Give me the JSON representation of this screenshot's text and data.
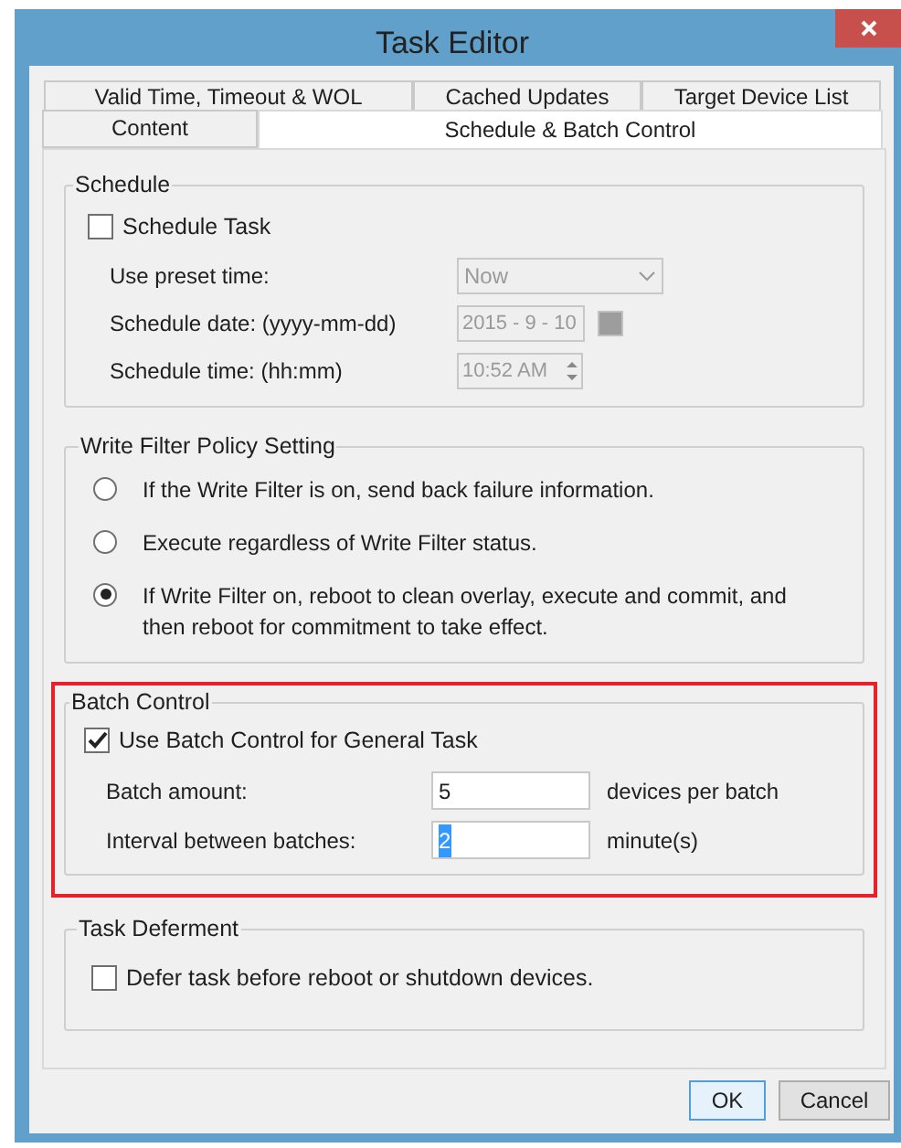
{
  "window": {
    "title": "Task Editor"
  },
  "tab_rows": [
    [
      {
        "label": "Valid Time, Timeout & WOL",
        "selected": false
      },
      {
        "label": "Cached Updates",
        "selected": false
      },
      {
        "label": "Target Device List",
        "selected": false
      }
    ],
    [
      {
        "label": "Content",
        "selected": false
      },
      {
        "label": "Schedule & Batch Control",
        "selected": true
      }
    ]
  ],
  "schedule": {
    "title": "Schedule",
    "schedule_task": {
      "label": "Schedule Task",
      "checked": false
    },
    "fields": [
      {
        "kind": "dropdown",
        "label": "Use preset time:",
        "value": "Now",
        "disabled": true
      },
      {
        "kind": "date",
        "label": "Schedule date: (yyyy-mm-dd)",
        "value": "2015 - 9 - 10",
        "disabled": true
      },
      {
        "kind": "time",
        "label": "Schedule time: (hh:mm)",
        "value": "10:52 AM",
        "disabled": true
      }
    ]
  },
  "write_filter": {
    "title": "Write Filter Policy Setting",
    "options": [
      {
        "label": "If the Write Filter is on, send back failure information.",
        "selected": false
      },
      {
        "label": "Execute regardless of Write Filter status.",
        "selected": false
      },
      {
        "label": "If Write Filter on, reboot to clean overlay, execute and commit, and then reboot for commitment to take effect.",
        "selected": true
      }
    ]
  },
  "batch_control": {
    "title": "Batch Control",
    "highlighted": true,
    "use_batch": {
      "label": "Use Batch Control for General Task",
      "checked": true
    },
    "fields": [
      {
        "label": "Batch amount:",
        "value": "5",
        "unit": "devices per batch",
        "text_selected": false
      },
      {
        "label": "Interval between batches:",
        "value": "2",
        "unit": "minute(s)",
        "text_selected": true
      }
    ]
  },
  "task_deferment": {
    "title": "Task Deferment",
    "defer": {
      "label": "Defer task before reboot or shutdown devices.",
      "checked": false
    }
  },
  "buttons": [
    {
      "label": "OK",
      "default": true
    },
    {
      "label": "Cancel",
      "default": false
    }
  ]
}
